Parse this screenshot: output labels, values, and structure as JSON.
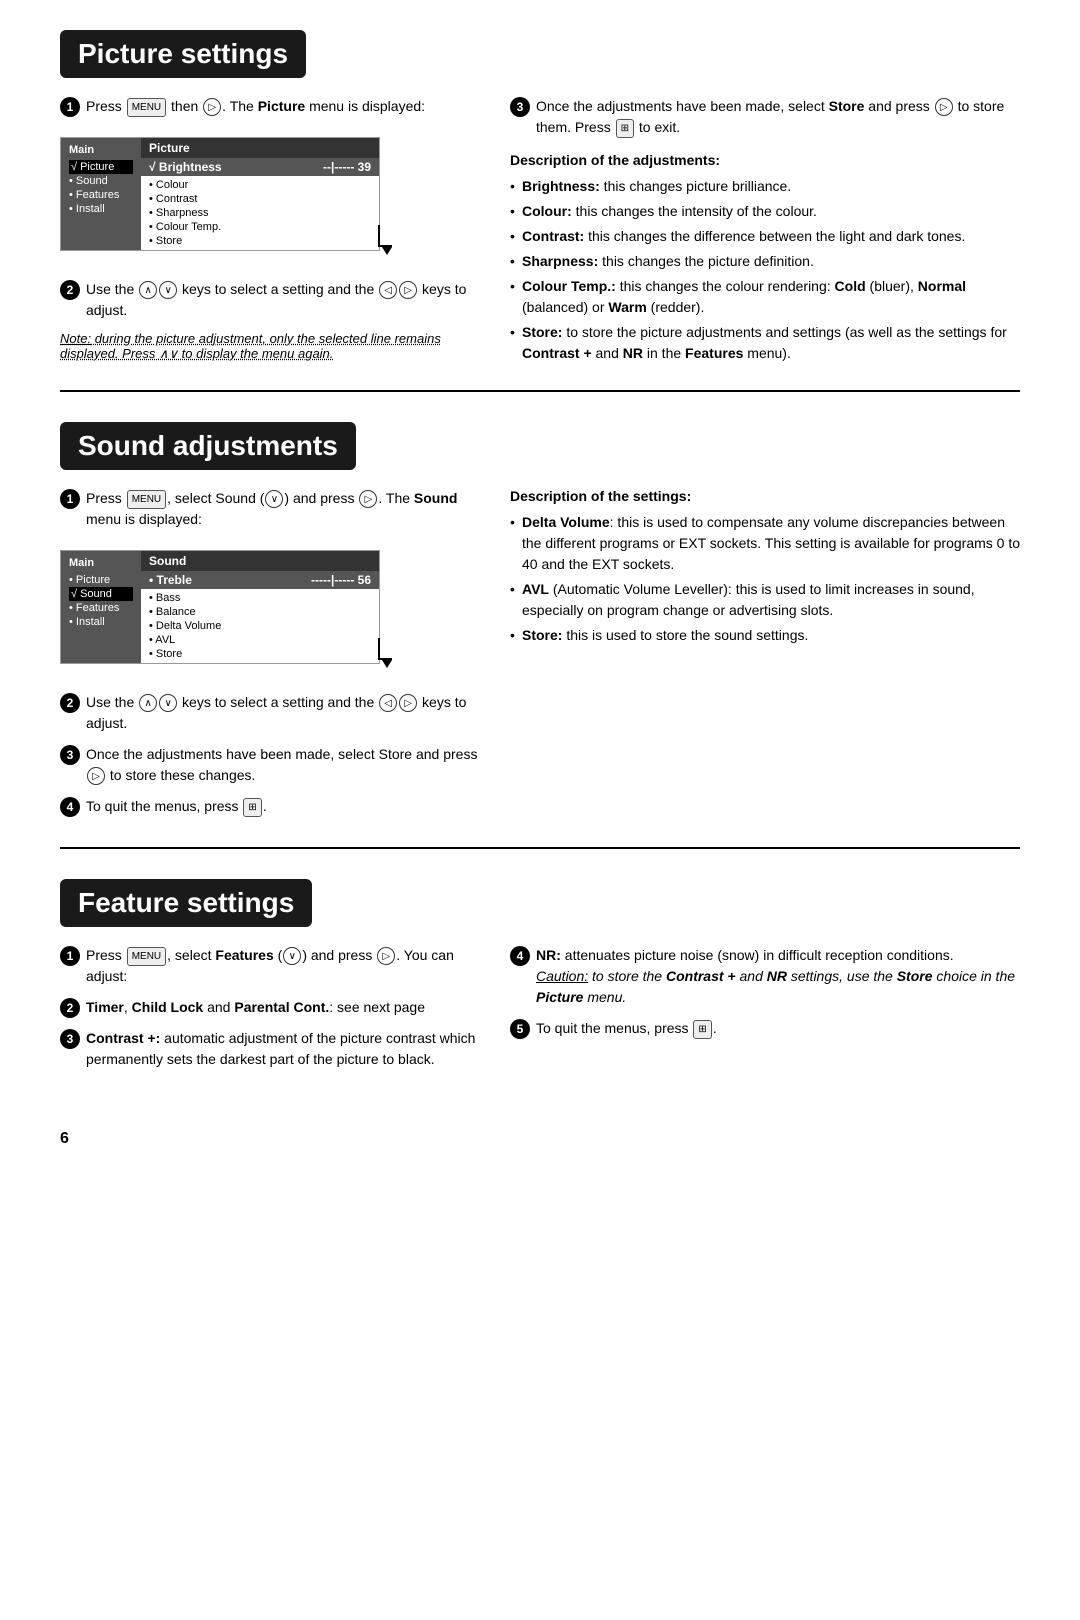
{
  "sections": [
    {
      "id": "picture-settings",
      "title": "Picture settings",
      "steps_left": [
        {
          "num": "1",
          "text_parts": [
            {
              "type": "text",
              "content": "Press "
            },
            {
              "type": "btn",
              "content": "MENU"
            },
            {
              "type": "text",
              "content": " then "
            },
            {
              "type": "btn-circle",
              "content": "▷"
            },
            {
              "type": "text",
              "content": ". The "
            },
            {
              "type": "bold",
              "content": "Picture"
            },
            {
              "type": "text",
              "content": " menu is displayed:"
            }
          ]
        },
        {
          "num": "2",
          "text_parts": [
            {
              "type": "text",
              "content": "Use the "
            },
            {
              "type": "btn-circle",
              "content": "∧∨"
            },
            {
              "type": "text",
              "content": " keys to select a setting and the "
            },
            {
              "type": "btn-circle",
              "content": "◁▷"
            },
            {
              "type": "text",
              "content": " keys to adjust."
            }
          ]
        }
      ],
      "note": "Note: during the picture adjustment, only the selected line remains displayed. Press ∧∨ to display the menu again.",
      "steps_right": [
        {
          "num": "3",
          "text_parts": [
            {
              "type": "text",
              "content": "Once the adjustments have been made, select "
            },
            {
              "type": "bold",
              "content": "Store"
            },
            {
              "type": "text",
              "content": " and press "
            },
            {
              "type": "btn-circle",
              "content": "▷"
            },
            {
              "type": "text",
              "content": " to store them. Press "
            },
            {
              "type": "btn-square",
              "content": "⊞"
            },
            {
              "type": "text",
              "content": " to exit."
            }
          ]
        }
      ],
      "desc_title": "Description of the adjustments:",
      "desc_items": [
        "<b>Brightness:</b> this changes picture brilliance.",
        "<b>Colour:</b> this changes the intensity of the colour.",
        "<b>Contrast:</b> this changes the difference between the light and dark tones.",
        "<b>Sharpness:</b> this changes the picture definition.",
        "<b>Colour Temp.:</b> this changes the colour rendering: <b>Cold</b> (bluer), <b>Normal</b> (balanced) or <b>Warm</b> (redder).",
        "<b>Store:</b> to store the picture adjustments and settings (as well as the settings for <b>Contrast +</b> and <b>NR</b> in the <b>Features</b> menu)."
      ],
      "menu": {
        "left_title": "Main",
        "left_items": [
          "• Picture",
          "• Sound",
          "• Features",
          "• Install"
        ],
        "active_left": 0,
        "right_title": "Picture",
        "right_selected": "√ Brightness",
        "right_value": "--|----- 39",
        "right_items": [
          "• Colour",
          "• Contrast",
          "• Sharpness",
          "• Colour Temp.",
          "• Store"
        ]
      }
    },
    {
      "id": "sound-adjustments",
      "title": "Sound adjustments",
      "steps_left": [
        {
          "num": "1",
          "text_parts": [
            {
              "type": "text",
              "content": "Press "
            },
            {
              "type": "btn",
              "content": "MENU"
            },
            {
              "type": "text",
              "content": ", select Sound ("
            },
            {
              "type": "btn-circle",
              "content": "∨"
            },
            {
              "type": "text",
              "content": ") and press "
            },
            {
              "type": "btn-circle",
              "content": "▷"
            },
            {
              "type": "text",
              "content": ". The "
            },
            {
              "type": "bold",
              "content": "Sound"
            },
            {
              "type": "text",
              "content": " menu is displayed:"
            }
          ]
        },
        {
          "num": "2",
          "text_parts": [
            {
              "type": "text",
              "content": "Use the "
            },
            {
              "type": "btn-circle",
              "content": "∧∨"
            },
            {
              "type": "text",
              "content": " keys to select a setting and the "
            },
            {
              "type": "btn-circle",
              "content": "◁▷"
            },
            {
              "type": "text",
              "content": " keys to adjust."
            }
          ]
        },
        {
          "num": "3",
          "text_parts": [
            {
              "type": "text",
              "content": "Once the adjustments have been made, select Store and press "
            },
            {
              "type": "btn-circle",
              "content": "▷"
            },
            {
              "type": "text",
              "content": " to store these changes."
            }
          ]
        },
        {
          "num": "4",
          "text_parts": [
            {
              "type": "text",
              "content": "To quit the menus, press "
            },
            {
              "type": "btn-square",
              "content": "⊞"
            },
            {
              "type": "text",
              "content": "."
            }
          ]
        }
      ],
      "desc_title": "Description of the settings:",
      "desc_items": [
        "<b>Delta Volume</b>: this is used to compensate any volume discrepancies between the different programs or EXT sockets. This setting is available for programs 0 to 40 and the EXT sockets.",
        "<b>AVL</b> (Automatic Volume Leveller): this is used to limit increases in sound, especially on program change or advertising slots.",
        "<b>Store:</b> this is used to store the sound settings."
      ],
      "menu": {
        "left_title": "Main",
        "left_items": [
          "• Picture",
          "• Sound",
          "• Features",
          "• Install"
        ],
        "active_left": 1,
        "right_title": "Sound",
        "right_selected": "• Treble",
        "right_value": "-----|----- 56",
        "right_items": [
          "• Bass",
          "• Balance",
          "• Delta Volume",
          "• AVL",
          "• Store"
        ]
      }
    },
    {
      "id": "feature-settings",
      "title": "Feature settings",
      "steps_left": [
        {
          "num": "1",
          "text_parts": [
            {
              "type": "text",
              "content": "Press "
            },
            {
              "type": "btn",
              "content": "MENU"
            },
            {
              "type": "text",
              "content": ", select "
            },
            {
              "type": "bold",
              "content": "Features"
            },
            {
              "type": "text",
              "content": " ("
            },
            {
              "type": "btn-circle",
              "content": "∨"
            },
            {
              "type": "text",
              "content": ") and press "
            },
            {
              "type": "btn-circle",
              "content": "▷"
            },
            {
              "type": "text",
              "content": ". You can adjust:"
            }
          ]
        },
        {
          "num": "2",
          "text_parts": [
            {
              "type": "bold",
              "content": "Timer"
            },
            {
              "type": "text",
              "content": ", "
            },
            {
              "type": "bold",
              "content": "Child Lock"
            },
            {
              "type": "text",
              "content": " and "
            },
            {
              "type": "bold",
              "content": "Parental Cont."
            },
            {
              "type": "text",
              "content": ": see next page"
            }
          ]
        },
        {
          "num": "3",
          "text_parts": [
            {
              "type": "bold",
              "content": "Contrast +:"
            },
            {
              "type": "text",
              "content": " automatic adjustment of the picture contrast which permanently sets the darkest part of the picture to black."
            }
          ]
        }
      ],
      "steps_right": [
        {
          "num": "4",
          "text_parts": [
            {
              "type": "bold",
              "content": "NR:"
            },
            {
              "type": "text",
              "content": " attenuates picture noise (snow) in difficult reception conditions."
            },
            {
              "type": "italic",
              "content": "Caution: to store the "
            },
            {
              "type": "bold-italic",
              "content": "Contrast +"
            },
            {
              "type": "italic",
              "content": " and "
            },
            {
              "type": "bold-italic",
              "content": "NR"
            },
            {
              "type": "italic",
              "content": " settings, use the "
            },
            {
              "type": "bold-italic",
              "content": "Store"
            },
            {
              "type": "italic",
              "content": " choice in the "
            },
            {
              "type": "bold-italic",
              "content": "Picture"
            },
            {
              "type": "italic",
              "content": " menu."
            }
          ]
        },
        {
          "num": "5",
          "text_parts": [
            {
              "type": "text",
              "content": "To quit the menus, press "
            },
            {
              "type": "btn-square",
              "content": "⊞"
            },
            {
              "type": "text",
              "content": "."
            }
          ]
        }
      ]
    }
  ],
  "page_number": "6",
  "labels": {
    "picture_settings": "Picture settings",
    "sound_adjustments": "Sound adjustments",
    "feature_settings": "Feature settings"
  }
}
